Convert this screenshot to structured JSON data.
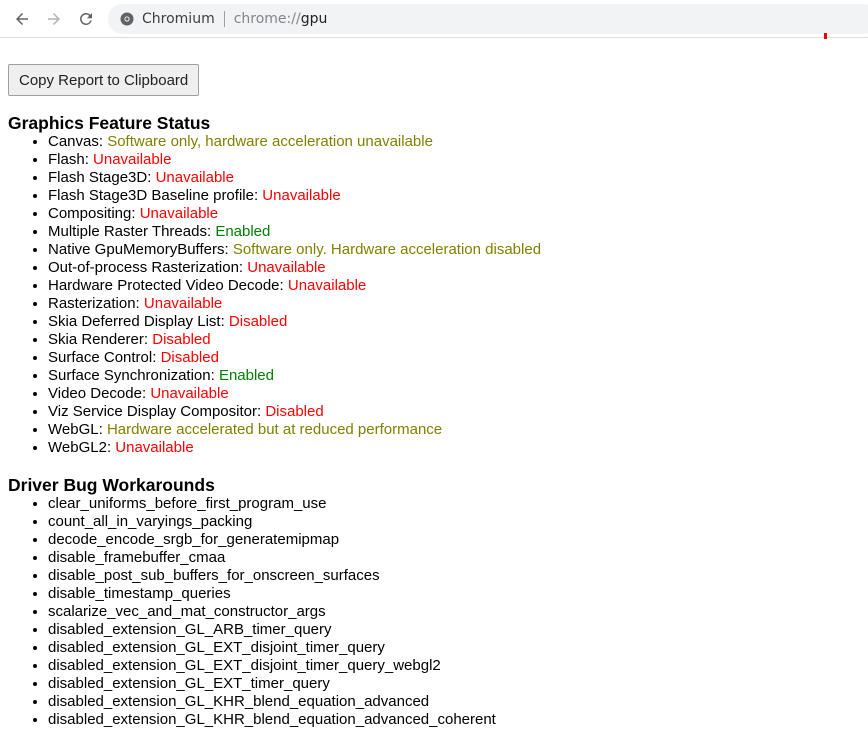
{
  "browser": {
    "site_name": "Chromium",
    "url_scheme": "chrome://",
    "url_host": "gpu"
  },
  "page": {
    "copy_button_label": "Copy Report to Clipboard",
    "feature_status": {
      "title": "Graphics Feature Status",
      "items": [
        {
          "name": "Canvas",
          "status": "Software only, hardware acceleration unavailable",
          "color": "#808000"
        },
        {
          "name": "Flash",
          "status": "Unavailable",
          "color": "#ff0000"
        },
        {
          "name": "Flash Stage3D",
          "status": "Unavailable",
          "color": "#ff0000"
        },
        {
          "name": "Flash Stage3D Baseline profile",
          "status": "Unavailable",
          "color": "#ff0000"
        },
        {
          "name": "Compositing",
          "status": "Unavailable",
          "color": "#ff0000"
        },
        {
          "name": "Multiple Raster Threads",
          "status": "Enabled",
          "color": "#008000"
        },
        {
          "name": "Native GpuMemoryBuffers",
          "status": "Software only. Hardware acceleration disabled",
          "color": "#808000"
        },
        {
          "name": "Out-of-process Rasterization",
          "status": "Unavailable",
          "color": "#ff0000"
        },
        {
          "name": "Hardware Protected Video Decode",
          "status": "Unavailable",
          "color": "#ff0000"
        },
        {
          "name": "Rasterization",
          "status": "Unavailable",
          "color": "#ff0000"
        },
        {
          "name": "Skia Deferred Display List",
          "status": "Disabled",
          "color": "#ff0000"
        },
        {
          "name": "Skia Renderer",
          "status": "Disabled",
          "color": "#ff0000"
        },
        {
          "name": "Surface Control",
          "status": "Disabled",
          "color": "#ff0000"
        },
        {
          "name": "Surface Synchronization",
          "status": "Enabled",
          "color": "#008000"
        },
        {
          "name": "Video Decode",
          "status": "Unavailable",
          "color": "#ff0000"
        },
        {
          "name": "Viz Service Display Compositor",
          "status": "Disabled",
          "color": "#ff0000"
        },
        {
          "name": "WebGL",
          "status": "Hardware accelerated but at reduced performance",
          "color": "#808000"
        },
        {
          "name": "WebGL2",
          "status": "Unavailable",
          "color": "#ff0000"
        }
      ]
    },
    "workarounds": {
      "title": "Driver Bug Workarounds",
      "items": [
        "clear_uniforms_before_first_program_use",
        "count_all_in_varyings_packing",
        "decode_encode_srgb_for_generatemipmap",
        "disable_framebuffer_cmaa",
        "disable_post_sub_buffers_for_onscreen_surfaces",
        "disable_timestamp_queries",
        "scalarize_vec_and_mat_constructor_args",
        "disabled_extension_GL_ARB_timer_query",
        "disabled_extension_GL_EXT_disjoint_timer_query",
        "disabled_extension_GL_EXT_disjoint_timer_query_webgl2",
        "disabled_extension_GL_EXT_timer_query",
        "disabled_extension_GL_KHR_blend_equation_advanced",
        "disabled_extension_GL_KHR_blend_equation_advanced_coherent"
      ]
    }
  }
}
